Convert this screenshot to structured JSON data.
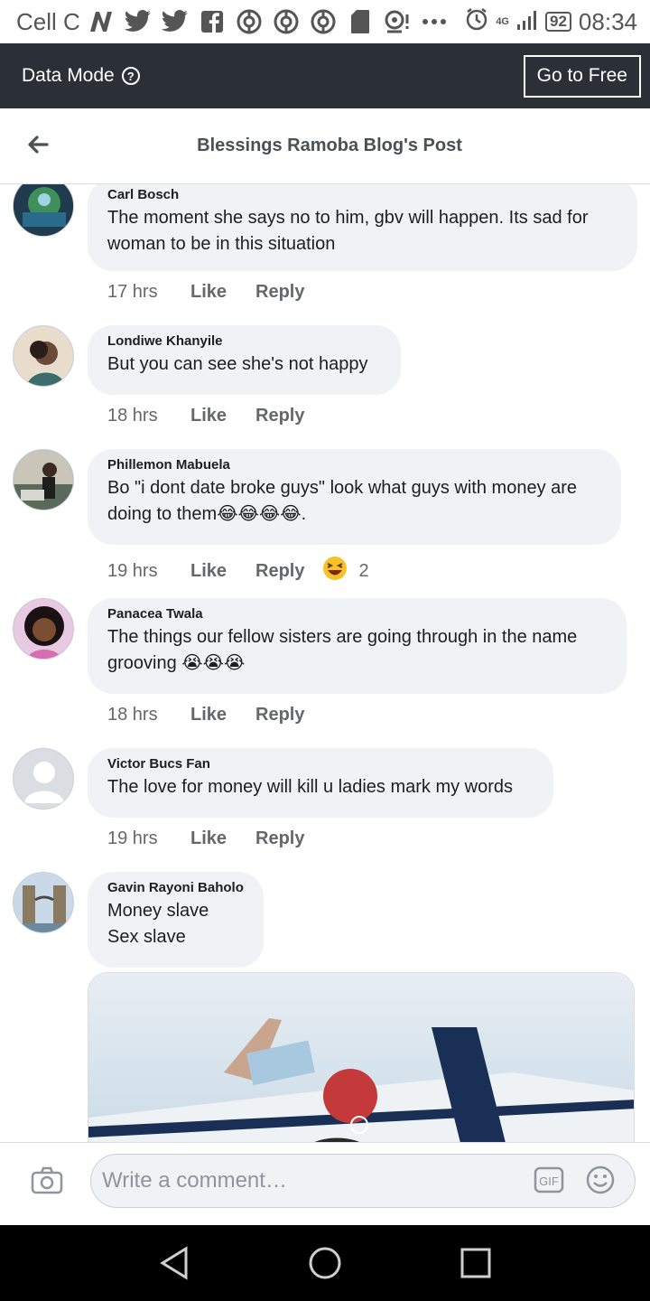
{
  "status_bar": {
    "carrier": "Cell C",
    "network": "4G",
    "battery": "92",
    "time": "08:34",
    "notification_icons": [
      "n-icon",
      "twitter-icon",
      "twitter-icon",
      "facebook-icon",
      "vpn-icon",
      "vpn-icon",
      "vpn-icon",
      "sdcard-icon",
      "location-icon"
    ]
  },
  "data_mode": {
    "label": "Data Mode",
    "cta": "Go to Free"
  },
  "header": {
    "title": "Blessings Ramoba Blog's Post"
  },
  "comments": [
    {
      "author": "Carl Bosch",
      "text": "The moment she says no to him, gbv will happen.  Its sad for woman to be in this situation",
      "time": "17 hrs",
      "like": "Like",
      "reply": "Reply"
    },
    {
      "author": "Londiwe Khanyile",
      "text": "But you can see she's not happy",
      "time": "18 hrs",
      "like": "Like",
      "reply": "Reply"
    },
    {
      "author": "Phillemon Mabuela",
      "text": "Bo \"i dont date broke guys\" look what guys with money are doing to them😂😂😂😂.",
      "time": "19 hrs",
      "like": "Like",
      "reply": "Reply",
      "reaction": {
        "emoji": "laugh",
        "count": "2"
      }
    },
    {
      "author": "Panacea Twala",
      "text": "The things our fellow sisters are going through in the name grooving 😭😭😭",
      "time": "18 hrs",
      "like": "Like",
      "reply": "Reply"
    },
    {
      "author": "Victor Bucs Fan",
      "text": "The love for money will kill u ladies mark my words",
      "time": "19 hrs",
      "like": "Like",
      "reply": "Reply"
    },
    {
      "author": "Gavin Rayoni Baholo",
      "text": "Money slave\nSex slave",
      "has_image": true
    }
  ],
  "composer": {
    "placeholder": "Write a comment…"
  },
  "colors": {
    "data_mode_bg": "#2b2f36",
    "bubble_bg": "#f0f2f5",
    "meta_text": "#65676b"
  }
}
